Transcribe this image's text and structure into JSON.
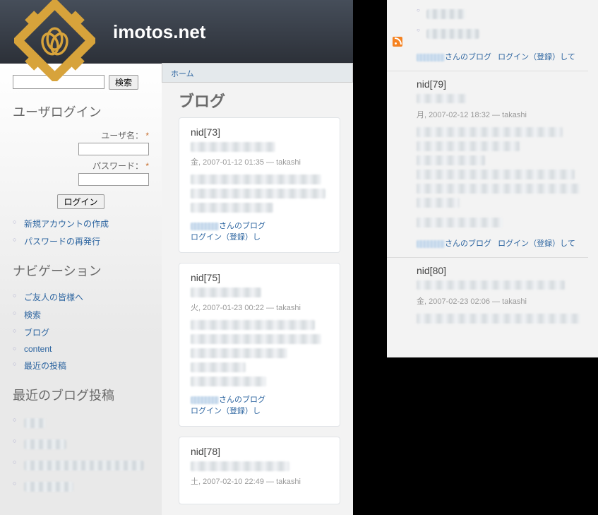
{
  "site_title": "imotos.net",
  "breadcrumb": "ホーム",
  "search": {
    "button": "検索"
  },
  "login": {
    "block_title": "ユーザログイン",
    "username_label": "ユーザ名：",
    "password_label": "パスワード：",
    "required_mark": "*",
    "button": "ログイン",
    "links": [
      "新規アカウントの作成",
      "パスワードの再発行"
    ]
  },
  "nav": {
    "block_title": "ナビゲーション",
    "items": [
      "ご友人の皆様へ",
      "検索",
      "ブログ",
      "content",
      "最近の投稿"
    ]
  },
  "recent": {
    "block_title": "最近のブログ投稿"
  },
  "main": {
    "page_title": "ブログ",
    "nodes": [
      {
        "title": "nid[73]",
        "meta": "金, 2007-01-12 01:35 — takashi",
        "blog_suffix": "さんのブログ",
        "login_link": "ログイン（登録）し"
      },
      {
        "title": "nid[75]",
        "meta": "火, 2007-01-23 00:22 — takashi",
        "blog_suffix": "さんのブログ",
        "login_link": "ログイン（登録）し"
      },
      {
        "title": "nid[78]",
        "meta": "土, 2007-02-10 22:49 — takashi",
        "blog_suffix": "",
        "login_link": ""
      }
    ]
  },
  "right": {
    "top_links": {
      "blog_suffix": "さんのブログ",
      "login_link": "ログイン（登録）して"
    },
    "nodes": [
      {
        "title": "nid[79]",
        "meta": "月, 2007-02-12 18:32 — takashi",
        "blog_suffix": "さんのブログ",
        "login_link": "ログイン（登録）して"
      },
      {
        "title": "nid[80]",
        "meta": "金, 2007-02-23 02:06 — takashi"
      }
    ]
  }
}
